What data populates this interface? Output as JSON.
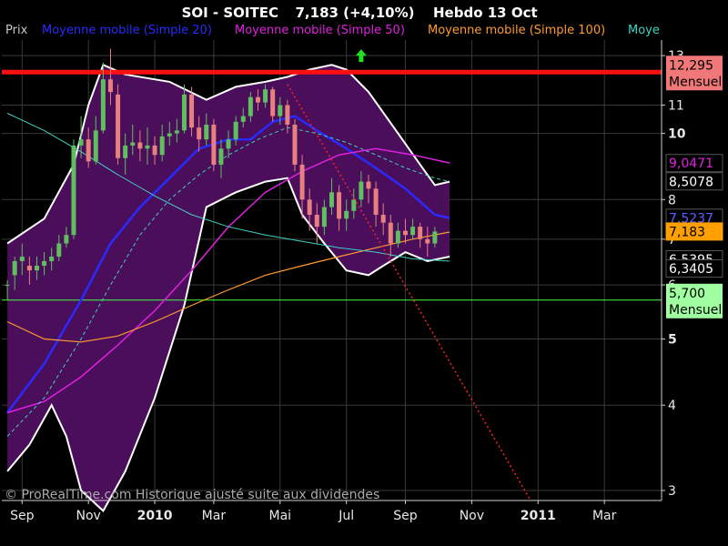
{
  "header": {
    "ticker": "SOI - SOITEC",
    "price_change": "7,183 (+4,10%)",
    "period_date": "Hebdo  13 Oct"
  },
  "legend": [
    {
      "label": "Prix",
      "color": "#c8c8c8"
    },
    {
      "label": "Moyenne mobile (Simple 20)",
      "color": "#2a2aff"
    },
    {
      "label": "Moyenne mobile (Simple 50)",
      "color": "#e020e0"
    },
    {
      "label": "Moyenne mobile (Simple 100)",
      "color": "#ff9a30"
    },
    {
      "label": "Moye",
      "color": "#40d0c0"
    }
  ],
  "footer": {
    "copyright": "© ProRealTime.com Historique ajusté suite aux dividendes"
  },
  "colors": {
    "background": "#000000",
    "band_fill": "#4a0e5a",
    "bullish_candle": "#5fbf5f",
    "bearish_candle": "#e88080",
    "resistance": "#ff1010",
    "support": "#40ff40",
    "trendline": "#ff2020",
    "grid": "#3a3a3a"
  },
  "chart_data": {
    "type": "candlestick",
    "period": "weekly",
    "y_scale": "log",
    "ylim": [
      2.9,
      13.7
    ],
    "grid": true,
    "x_ticks": [
      {
        "label": "Sep",
        "week": 2,
        "year": false
      },
      {
        "label": "Nov",
        "week": 11,
        "year": false
      },
      {
        "label": "2010",
        "week": 20,
        "year": true
      },
      {
        "label": "Mar",
        "week": 28,
        "year": false
      },
      {
        "label": "Mai",
        "week": 37,
        "year": false
      },
      {
        "label": "Jul",
        "week": 46,
        "year": false
      },
      {
        "label": "Sep",
        "week": 54,
        "year": false
      },
      {
        "label": "Nov",
        "week": 63,
        "year": false
      },
      {
        "label": "2011",
        "week": 72,
        "year": true
      },
      {
        "label": "Mar",
        "week": 81,
        "year": false
      }
    ],
    "y_ticks": [
      3,
      4,
      5,
      6,
      7,
      8,
      10,
      11,
      13
    ],
    "levels": [
      {
        "name": "resistance",
        "value": 12.295,
        "label": "12,295",
        "sub": "Mensuel",
        "color": "#ff1010",
        "box": "#f07878",
        "text": "#000"
      },
      {
        "name": "support",
        "value": 5.7,
        "label": "5,700",
        "sub": "Mensuel",
        "color": "#40ff40",
        "box": "#a0ffa0",
        "text": "#000"
      }
    ],
    "value_tags": [
      {
        "label": "9,0471",
        "value": 9.0471,
        "text": "#e020e0",
        "box": "#000",
        "border": "#555"
      },
      {
        "label": "8,5078",
        "value": 8.5078,
        "text": "#ffffff",
        "box": "#000",
        "border": "#555"
      },
      {
        "label": "7,5237",
        "value": 7.5237,
        "text": "#6060ff",
        "box": "#000",
        "border": "#555"
      },
      {
        "label": "7,183",
        "value": 7.183,
        "text": "#000000",
        "box": "#ffa000",
        "border": "#ffa000"
      },
      {
        "label": "6,5395",
        "value": 6.5395,
        "text": "#ffffff",
        "box": "#000",
        "border": "#555"
      },
      {
        "label": "6,3405",
        "value": 6.3405,
        "text": "#ffffff",
        "box": "#000",
        "border": "#555"
      }
    ],
    "trendline": {
      "from": {
        "week": 38,
        "value": 11.8
      },
      "to": {
        "week": 71,
        "value": 2.9
      }
    },
    "up_arrow": {
      "week": 48,
      "value": 13.0
    },
    "candles": [
      [
        6.0,
        6.0,
        5.7,
        6.1
      ],
      [
        6.2,
        6.5,
        5.9,
        6.6
      ],
      [
        6.5,
        6.6,
        6.2,
        6.9
      ],
      [
        6.4,
        6.3,
        6.0,
        6.6
      ],
      [
        6.3,
        6.4,
        6.1,
        6.6
      ],
      [
        6.4,
        6.5,
        6.2,
        6.7
      ],
      [
        6.5,
        6.6,
        6.3,
        6.8
      ],
      [
        6.6,
        6.9,
        6.5,
        7.1
      ],
      [
        6.9,
        7.1,
        6.8,
        7.3
      ],
      [
        7.1,
        9.6,
        7.0,
        9.8
      ],
      [
        9.6,
        9.8,
        9.2,
        10.6
      ],
      [
        9.8,
        9.1,
        8.9,
        10.2
      ],
      [
        9.1,
        10.1,
        9.0,
        10.6
      ],
      [
        10.1,
        12.0,
        10.0,
        12.7
      ],
      [
        12.0,
        11.5,
        11.0,
        13.3
      ],
      [
        11.4,
        9.2,
        9.0,
        11.8
      ],
      [
        9.2,
        9.6,
        8.7,
        10.0
      ],
      [
        9.6,
        9.7,
        9.3,
        10.3
      ],
      [
        9.7,
        9.5,
        9.1,
        10.1
      ],
      [
        9.5,
        9.6,
        9.0,
        10.2
      ],
      [
        9.6,
        9.3,
        9.0,
        9.9
      ],
      [
        9.3,
        9.9,
        9.1,
        10.3
      ],
      [
        9.9,
        10.0,
        9.6,
        10.4
      ],
      [
        10.0,
        10.1,
        9.7,
        10.5
      ],
      [
        10.1,
        11.4,
        10.0,
        11.8
      ],
      [
        11.4,
        10.2,
        9.9,
        11.7
      ],
      [
        10.2,
        9.8,
        9.4,
        10.6
      ],
      [
        9.8,
        10.3,
        9.6,
        10.7
      ],
      [
        10.3,
        9.0,
        8.8,
        10.5
      ],
      [
        9.0,
        9.5,
        8.6,
        9.8
      ],
      [
        9.5,
        9.8,
        9.2,
        10.1
      ],
      [
        9.8,
        10.4,
        9.6,
        10.6
      ],
      [
        10.4,
        10.6,
        10.2,
        10.9
      ],
      [
        10.6,
        11.3,
        10.4,
        11.5
      ],
      [
        11.3,
        11.1,
        10.8,
        11.6
      ],
      [
        11.1,
        11.6,
        10.9,
        11.8
      ],
      [
        11.6,
        10.6,
        10.4,
        11.7
      ],
      [
        10.6,
        11.0,
        10.3,
        11.3
      ],
      [
        11.0,
        10.3,
        10.0,
        11.2
      ],
      [
        10.3,
        9.0,
        8.8,
        10.5
      ],
      [
        9.0,
        8.0,
        7.5,
        9.3
      ],
      [
        8.0,
        7.6,
        7.2,
        8.3
      ],
      [
        7.6,
        7.3,
        6.9,
        7.9
      ],
      [
        7.3,
        7.8,
        7.1,
        8.0
      ],
      [
        7.8,
        8.2,
        7.6,
        8.6
      ],
      [
        8.2,
        7.5,
        7.2,
        8.4
      ],
      [
        7.5,
        7.7,
        7.2,
        8.0
      ],
      [
        7.7,
        8.0,
        7.5,
        8.3
      ],
      [
        8.0,
        8.5,
        7.8,
        8.8
      ],
      [
        8.5,
        8.3,
        7.9,
        8.7
      ],
      [
        8.3,
        7.6,
        7.3,
        8.5
      ],
      [
        7.6,
        7.4,
        7.1,
        7.9
      ],
      [
        7.4,
        6.9,
        6.6,
        7.6
      ],
      [
        6.9,
        7.2,
        6.8,
        7.4
      ],
      [
        7.2,
        7.1,
        6.9,
        7.5
      ],
      [
        7.1,
        7.3,
        7.0,
        7.5
      ],
      [
        7.3,
        7.0,
        6.8,
        7.4
      ],
      [
        7.0,
        6.9,
        6.6,
        7.3
      ],
      [
        6.9,
        7.183,
        6.8,
        7.3
      ]
    ],
    "series": [
      {
        "name": "Moyenne mobile (Simple 20)",
        "color": "#2a2aff",
        "width": 2.5,
        "dash": "",
        "points": [
          [
            0,
            3.9
          ],
          [
            5,
            4.6
          ],
          [
            10,
            5.7
          ],
          [
            14,
            6.9
          ],
          [
            18,
            7.8
          ],
          [
            22,
            8.6
          ],
          [
            26,
            9.5
          ],
          [
            30,
            9.8
          ],
          [
            33,
            9.8
          ],
          [
            36,
            10.4
          ],
          [
            39,
            10.6
          ],
          [
            42,
            10.1
          ],
          [
            46,
            9.5
          ],
          [
            50,
            8.9
          ],
          [
            54,
            8.3
          ],
          [
            58,
            7.6
          ],
          [
            60,
            7.52
          ]
        ]
      },
      {
        "name": "Moyenne mobile (Simple 50)",
        "color": "#e020e0",
        "width": 1.5,
        "dash": "",
        "points": [
          [
            0,
            3.9
          ],
          [
            5,
            4.05
          ],
          [
            10,
            4.4
          ],
          [
            15,
            4.9
          ],
          [
            20,
            5.5
          ],
          [
            25,
            6.3
          ],
          [
            30,
            7.3
          ],
          [
            35,
            8.2
          ],
          [
            40,
            8.8
          ],
          [
            45,
            9.3
          ],
          [
            50,
            9.5
          ],
          [
            55,
            9.3
          ],
          [
            60,
            9.05
          ]
        ]
      },
      {
        "name": "Moyenne mobile (Simple 100)",
        "color": "#ff9a30",
        "width": 1.2,
        "dash": "",
        "points": [
          [
            0,
            5.3
          ],
          [
            5,
            5.0
          ],
          [
            10,
            4.95
          ],
          [
            15,
            5.05
          ],
          [
            20,
            5.3
          ],
          [
            25,
            5.6
          ],
          [
            30,
            5.9
          ],
          [
            35,
            6.2
          ],
          [
            40,
            6.4
          ],
          [
            45,
            6.6
          ],
          [
            50,
            6.8
          ],
          [
            55,
            7.0
          ],
          [
            60,
            7.17
          ]
        ]
      },
      {
        "name": "Moye",
        "color": "#40d0c0",
        "width": 1,
        "dash": "",
        "points": [
          [
            0,
            10.7
          ],
          [
            5,
            10.1
          ],
          [
            10,
            9.4
          ],
          [
            15,
            8.7
          ],
          [
            20,
            8.1
          ],
          [
            25,
            7.6
          ],
          [
            30,
            7.3
          ],
          [
            35,
            7.1
          ],
          [
            40,
            6.95
          ],
          [
            45,
            6.8
          ],
          [
            50,
            6.7
          ],
          [
            55,
            6.55
          ],
          [
            60,
            6.5
          ]
        ]
      },
      {
        "name": "",
        "color": "#40d0c0",
        "width": 1,
        "dash": "4,3",
        "points": [
          [
            0,
            3.6
          ],
          [
            5,
            4.1
          ],
          [
            10,
            5.0
          ],
          [
            14,
            6.0
          ],
          [
            18,
            7.1
          ],
          [
            22,
            8.0
          ],
          [
            26,
            8.7
          ],
          [
            30,
            9.3
          ],
          [
            34,
            9.8
          ],
          [
            38,
            10.2
          ],
          [
            42,
            10.0
          ],
          [
            46,
            9.7
          ],
          [
            50,
            9.3
          ],
          [
            54,
            8.9
          ],
          [
            58,
            8.6
          ],
          [
            60,
            8.5
          ]
        ]
      }
    ],
    "bollinger": {
      "upper": [
        [
          0,
          6.9
        ],
        [
          5,
          7.5
        ],
        [
          9,
          9.0
        ],
        [
          11,
          11.0
        ],
        [
          13,
          12.6
        ],
        [
          16,
          12.2
        ],
        [
          22,
          11.9
        ],
        [
          27,
          11.2
        ],
        [
          31,
          11.7
        ],
        [
          35,
          11.9
        ],
        [
          38,
          12.1
        ],
        [
          41,
          12.4
        ],
        [
          44,
          12.6
        ],
        [
          46,
          12.4
        ],
        [
          49,
          11.5
        ],
        [
          53,
          10.0
        ],
        [
          56,
          9.0
        ],
        [
          58,
          8.4
        ],
        [
          60,
          8.5
        ]
      ],
      "lower": [
        [
          0,
          3.2
        ],
        [
          3,
          3.5
        ],
        [
          6,
          4.0
        ],
        [
          8,
          3.6
        ],
        [
          10,
          3.0
        ],
        [
          13,
          2.8
        ],
        [
          16,
          3.2
        ],
        [
          20,
          4.1
        ],
        [
          24,
          5.6
        ],
        [
          27,
          7.8
        ],
        [
          31,
          8.2
        ],
        [
          35,
          8.5
        ],
        [
          38,
          8.6
        ],
        [
          40,
          7.6
        ],
        [
          43,
          6.9
        ],
        [
          46,
          6.3
        ],
        [
          49,
          6.2
        ],
        [
          51,
          6.4
        ],
        [
          54,
          6.7
        ],
        [
          57,
          6.5
        ],
        [
          60,
          6.6
        ]
      ]
    }
  }
}
